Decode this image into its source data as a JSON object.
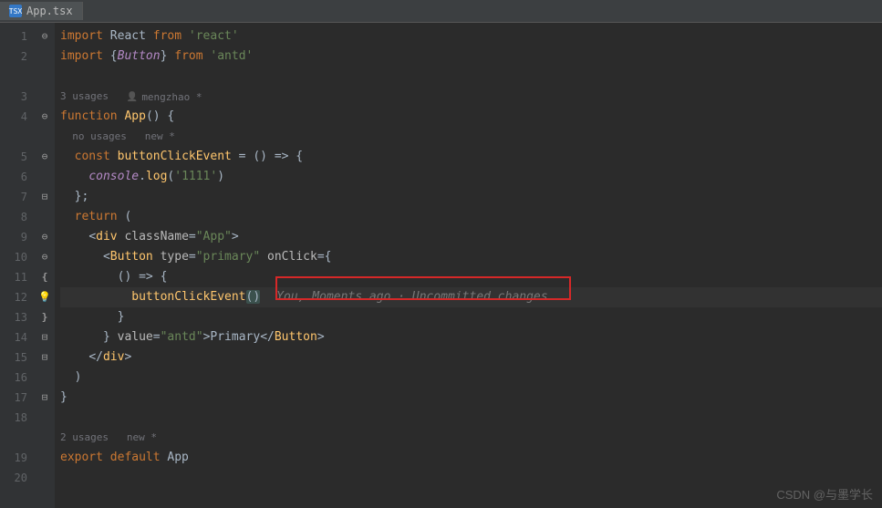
{
  "tab": {
    "filename": "App.tsx",
    "icon": "TSX"
  },
  "gutter": [
    "1",
    "2",
    "",
    "3",
    "4",
    "",
    "5",
    "6",
    "7",
    "8",
    "9",
    "10",
    "11",
    "12",
    "13",
    "14",
    "15",
    "16",
    "17",
    "18",
    "",
    "19",
    "20"
  ],
  "hints": {
    "usages3": "3 usages",
    "author": "mengzhao *",
    "nousages": "no usages",
    "new": "new *",
    "usages2": "2 usages"
  },
  "code": {
    "l1": {
      "kw": "import",
      "sym": "React",
      "from": "from",
      "pkg": "'react'"
    },
    "l2": {
      "kw": "import",
      "brace_o": "{",
      "imp": "Button",
      "brace_c": "}",
      "from": "from",
      "pkg": "'antd'"
    },
    "l4": {
      "kw": "function",
      "name": "App",
      "rest": "() {"
    },
    "l5": {
      "kw": "const",
      "name": "buttonClickEvent",
      "rest": " = () => {"
    },
    "l6": {
      "obj": "console",
      "dot": ".",
      "method": "log",
      "open": "(",
      "str": "'1111'",
      "close": ")"
    },
    "l7": "};",
    "l8": {
      "kw": "return",
      "rest": " ("
    },
    "l9": {
      "open": "<",
      "tag": "div",
      "attr": "className",
      "eq": "=",
      "val": "\"App\"",
      "close": ">"
    },
    "l10": {
      "open": "<",
      "tag": "Button",
      "attr1": "type",
      "val1": "\"primary\"",
      "attr2": "onClick",
      "eq": "=",
      "brace": "{"
    },
    "l11": "() => {",
    "l12": {
      "fn": "buttonClickEvent",
      "paren": "()"
    },
    "l13": "}",
    "l14": {
      "brace": "}",
      "attr": "value",
      "eq": "=",
      "val": "\"antd\"",
      "close1": ">",
      "text": "Primary",
      "close2": "</",
      "tag": "Button",
      "close3": ">"
    },
    "l15": {
      "open": "</",
      "tag": "div",
      "close": ">"
    },
    "l16": ")",
    "l17": "}",
    "l19": {
      "kw": "export default",
      "name": "App"
    }
  },
  "gitlens": "You, Moments ago · Uncommitted changes",
  "watermark": "CSDN @与墨学长"
}
